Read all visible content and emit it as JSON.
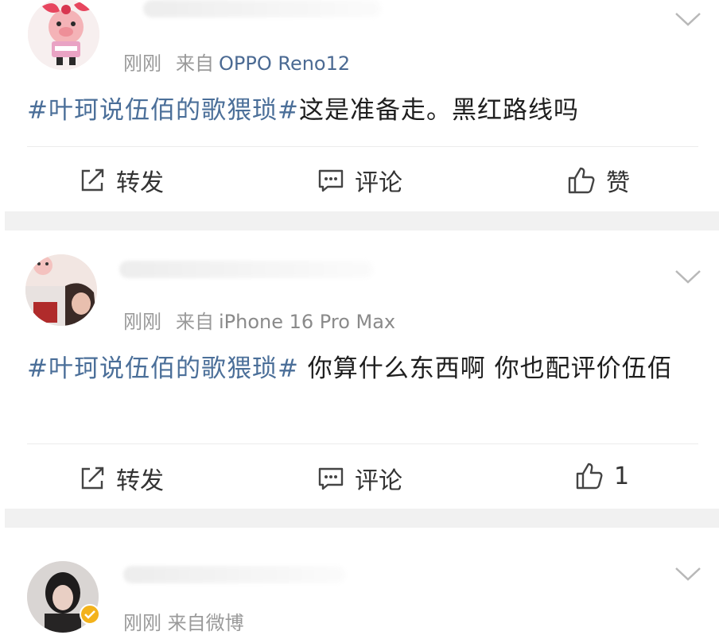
{
  "posts": [
    {
      "time": "刚刚",
      "from": "来自",
      "device": "OPPO Reno12",
      "hashtag": "#叶珂说伍佰的歌猥琐#",
      "content": "这是准备走。黑红路线吗",
      "actions": {
        "repost": "转发",
        "comment": "评论",
        "like": "赞"
      }
    },
    {
      "time": "刚刚",
      "from": "来自",
      "device": "iPhone 16 Pro Max",
      "hashtag": "#叶珂说伍佰的歌猥琐#",
      "content": " 你算什么东西啊 你也配评价伍佰",
      "actions": {
        "repost": "转发",
        "comment": "评论",
        "like": "1"
      }
    },
    {
      "meta_partial": "刚刚 来自微博"
    }
  ],
  "colors": {
    "tag": "#4b6f99",
    "meta": "#9a9a9a",
    "device_link": "#4b6a93"
  }
}
